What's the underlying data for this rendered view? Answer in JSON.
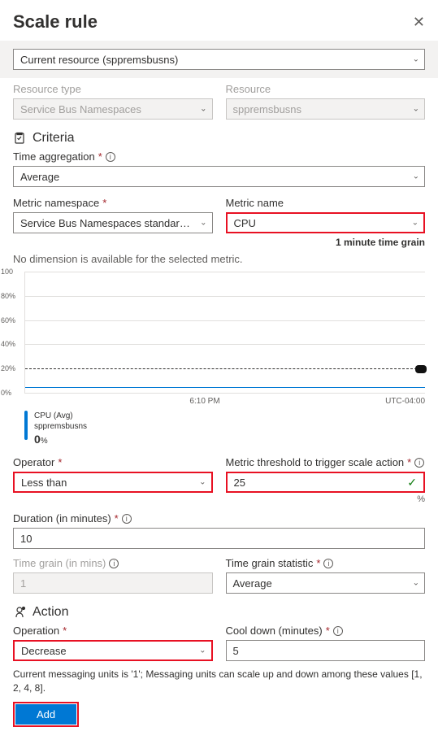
{
  "header": {
    "title": "Scale rule"
  },
  "resource_selector": {
    "value": "Current resource (sppremsbusns)"
  },
  "resource_type": {
    "label": "Resource type",
    "value": "Service Bus Namespaces"
  },
  "resource": {
    "label": "Resource",
    "value": "sppremsbusns"
  },
  "criteria": {
    "title": "Criteria",
    "time_aggregation": {
      "label": "Time aggregation",
      "value": "Average"
    },
    "metric_namespace": {
      "label": "Metric namespace",
      "value": "Service Bus Namespaces standard me..."
    },
    "metric_name": {
      "label": "Metric name",
      "value": "CPU",
      "grain_note": "1 minute time grain"
    },
    "no_dimension": "No dimension is available for the selected metric.",
    "operator": {
      "label": "Operator",
      "value": "Less than"
    },
    "threshold": {
      "label": "Metric threshold to trigger scale action",
      "value": "25",
      "unit": "%"
    },
    "duration": {
      "label": "Duration (in minutes)",
      "value": "10"
    },
    "time_grain": {
      "label": "Time grain (in mins)",
      "value": "1"
    },
    "time_grain_statistic": {
      "label": "Time grain statistic",
      "value": "Average"
    }
  },
  "action": {
    "title": "Action",
    "operation": {
      "label": "Operation",
      "value": "Decrease"
    },
    "cooldown": {
      "label": "Cool down (minutes)",
      "value": "5"
    },
    "helper": "Current messaging units is '1'; Messaging units can scale up and down among these values [1, 2, 4, 8]."
  },
  "button": {
    "add": "Add"
  },
  "chart_data": {
    "type": "line",
    "title": "",
    "xlabel": "",
    "ylabel": "",
    "ylim": [
      0,
      100
    ],
    "y_ticks": [
      0,
      20,
      40,
      60,
      80,
      100
    ],
    "threshold_line": 20,
    "x_ticks": [
      "6:10 PM"
    ],
    "tz": "UTC-04:00",
    "series": [
      {
        "name": "CPU (Avg)",
        "resource": "sppremsbusns",
        "values": [
          0,
          0,
          0,
          0,
          0,
          0,
          0,
          0,
          0,
          0
        ],
        "current": 0,
        "unit": "%",
        "color": "#0078d4"
      }
    ]
  }
}
